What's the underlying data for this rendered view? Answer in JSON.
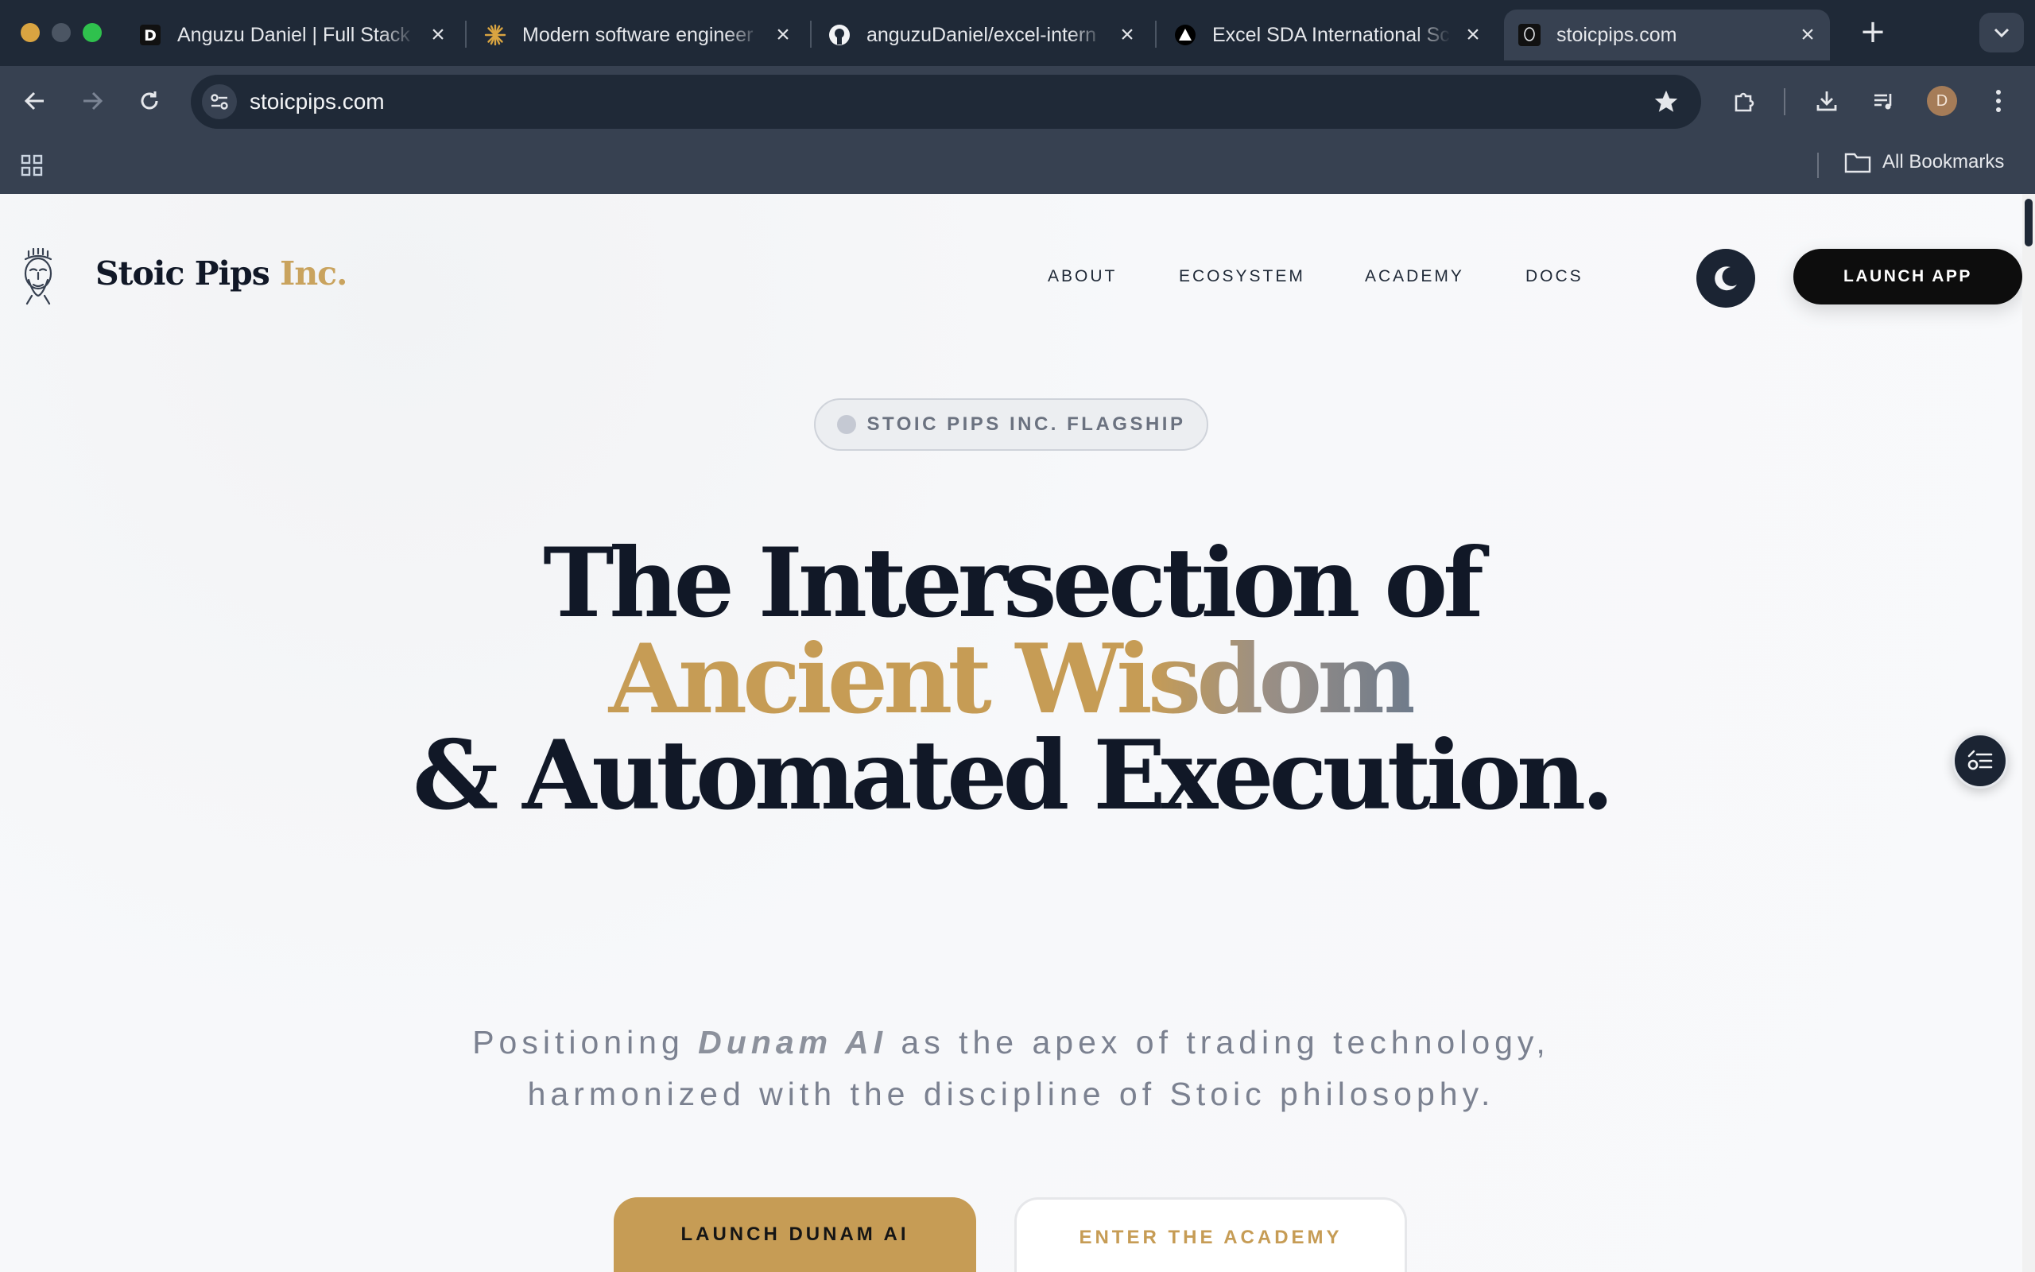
{
  "browser": {
    "tabs": [
      {
        "title": "Anguzu Daniel | Full Stack",
        "favicon": "letter-d-icon",
        "active": false
      },
      {
        "title": "Modern software engineer",
        "favicon": "sunburst-icon",
        "active": false
      },
      {
        "title": "anguzuDaniel/excel-intern",
        "favicon": "github-icon",
        "active": false
      },
      {
        "title": "Excel SDA International Sc",
        "favicon": "triangle-icon",
        "active": false
      },
      {
        "title": "stoicpips.com",
        "favicon": "bust-icon",
        "active": true
      }
    ],
    "new_tab_label": "+",
    "url": "stoicpips.com",
    "profile_initial": "D",
    "bookmarks_label": "All Bookmarks"
  },
  "site": {
    "brand_main": "Stoic Pips",
    "brand_suffix": "Inc.",
    "nav": [
      "ABOUT",
      "ECOSYSTEM",
      "ACADEMY",
      "DOCS"
    ],
    "launch_label": "LAUNCH APP",
    "badge": "STOIC PIPS INC. FLAGSHIP",
    "headline_1": "The Intersection of",
    "headline_2a": "Ancient Wi",
    "headline_2b": "sdom",
    "headline_3": "& Automated Execution.",
    "sub_pre": "Positioning ",
    "sub_em": "Dunam AI",
    "sub_post": " as the apex of trading technology,",
    "sub_line2": "harmonized with the discipline of Stoic philosophy.",
    "cta_primary": "LAUNCH DUNAM AI",
    "cta_secondary": "ENTER THE ACADEMY"
  },
  "colors": {
    "accent_gold": "#c69c55",
    "ink": "#111827",
    "chrome_dark": "#1f2937",
    "chrome": "#374151"
  }
}
